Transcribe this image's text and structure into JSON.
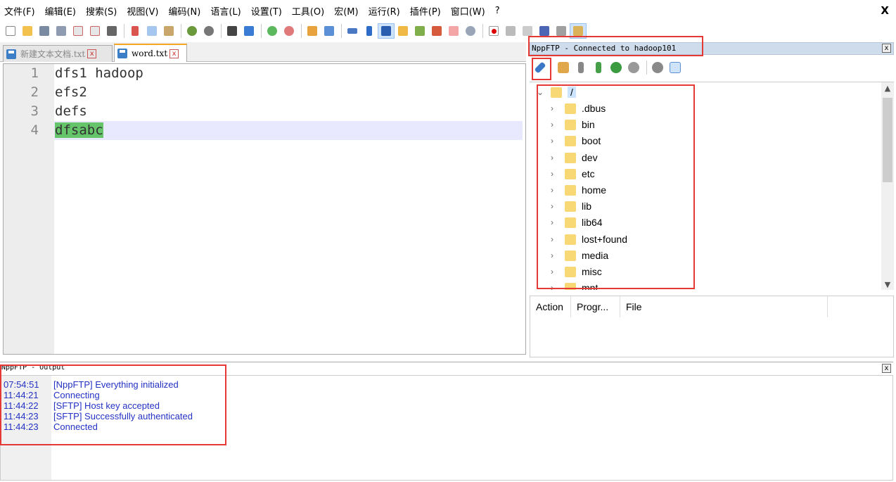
{
  "menu": [
    "文件(F)",
    "编辑(E)",
    "搜索(S)",
    "视图(V)",
    "编码(N)",
    "语言(L)",
    "设置(T)",
    "工具(O)",
    "宏(M)",
    "运行(R)",
    "插件(P)",
    "窗口(W)",
    "?"
  ],
  "window_close": "X",
  "tabs": [
    {
      "label": "新建文本文档.txt",
      "close": "x"
    },
    {
      "label": "word.txt",
      "close": "x"
    }
  ],
  "editor": {
    "lines": [
      {
        "num": "1",
        "text": "dfs1 hadoop"
      },
      {
        "num": "2",
        "text": "efs2"
      },
      {
        "num": "3",
        "text": "defs"
      },
      {
        "num": "4",
        "text": "dfsabc"
      }
    ]
  },
  "ftp": {
    "title": "NppFTP - Connected to hadoop101",
    "close": "x",
    "root": "/",
    "folders": [
      ".dbus",
      "bin",
      "boot",
      "dev",
      "etc",
      "home",
      "lib",
      "lib64",
      "lost+found",
      "media",
      "misc",
      "mnt"
    ],
    "queue_columns": [
      "Action",
      "Progr...",
      "File"
    ]
  },
  "output": {
    "title": "NppFTP - Output",
    "close": "x",
    "logs": [
      {
        "time": "07:54:51",
        "msg": "[NppFTP] Everything initialized"
      },
      {
        "time": "11:44:21",
        "msg": "Connecting"
      },
      {
        "time": "11:44:22",
        "msg": "[SFTP] Host key accepted"
      },
      {
        "time": "11:44:23",
        "msg": "[SFTP] Successfully authenticated"
      },
      {
        "time": "11:44:23",
        "msg": "Connected"
      }
    ]
  },
  "colors": {
    "accent": "#e53935",
    "log_text": "#2432c4",
    "selection": "#66c46a"
  }
}
